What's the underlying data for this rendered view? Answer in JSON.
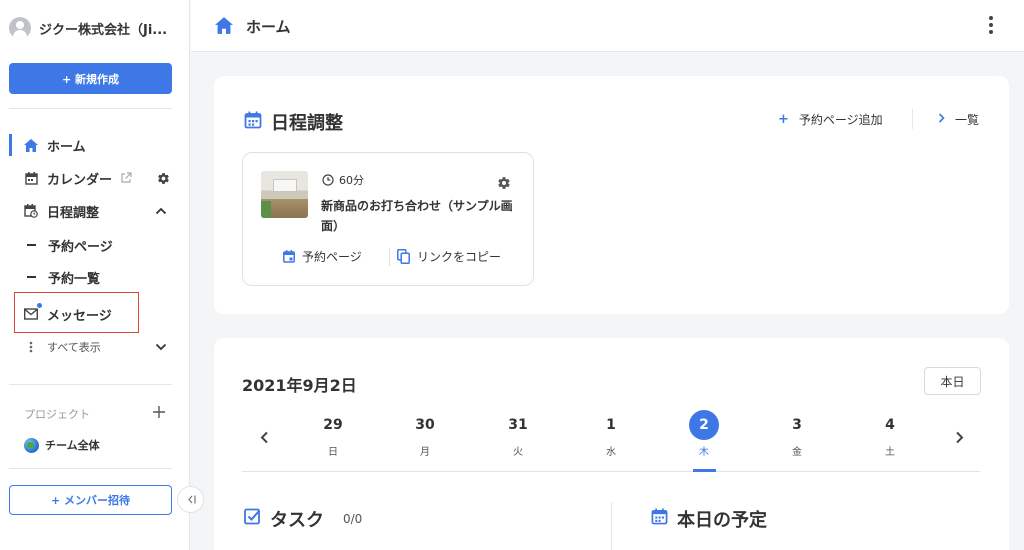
{
  "sidebar": {
    "org_name": "ジクー株式会社（Ji...",
    "new_button": "+ 新規作成",
    "items": [
      {
        "label": "ホーム",
        "icon": "home-icon",
        "active": true
      },
      {
        "label": "カレンダー",
        "icon": "calendar-icon"
      },
      {
        "label": "日程調整",
        "icon": "schedule-icon"
      },
      {
        "label": "予約ページ"
      },
      {
        "label": "予約一覧"
      },
      {
        "label": "メッセージ",
        "icon": "mail-icon"
      },
      {
        "label": "すべて表示",
        "icon": "more-vertical-icon"
      }
    ],
    "project_label": "プロジェクト",
    "team_label": "チーム全体",
    "invite_button": "+ メンバー招待"
  },
  "header": {
    "title": "ホーム"
  },
  "scheduling": {
    "title": "日程調整",
    "add_page": "予約ページ追加",
    "list_link": "一覧",
    "card": {
      "duration": "60分",
      "title": "新商品のお打ち合わせ（サンプル画面）",
      "booking_page": "予約ページ",
      "copy_link": "リンクをコピー"
    }
  },
  "calendar": {
    "date_title": "2021年9月2日",
    "today_button": "本日",
    "days": [
      {
        "num": "29",
        "wd": "日"
      },
      {
        "num": "30",
        "wd": "月"
      },
      {
        "num": "31",
        "wd": "火"
      },
      {
        "num": "1",
        "wd": "水"
      },
      {
        "num": "2",
        "wd": "木",
        "selected": true
      },
      {
        "num": "3",
        "wd": "金"
      },
      {
        "num": "4",
        "wd": "土"
      }
    ]
  },
  "tasks": {
    "title": "タスク",
    "count": "0/0"
  },
  "today_events": {
    "title": "本日の予定"
  },
  "colors": {
    "accent": "#3d78e6",
    "highlight_border": "#e0453a",
    "background": "#f4f5f7"
  }
}
